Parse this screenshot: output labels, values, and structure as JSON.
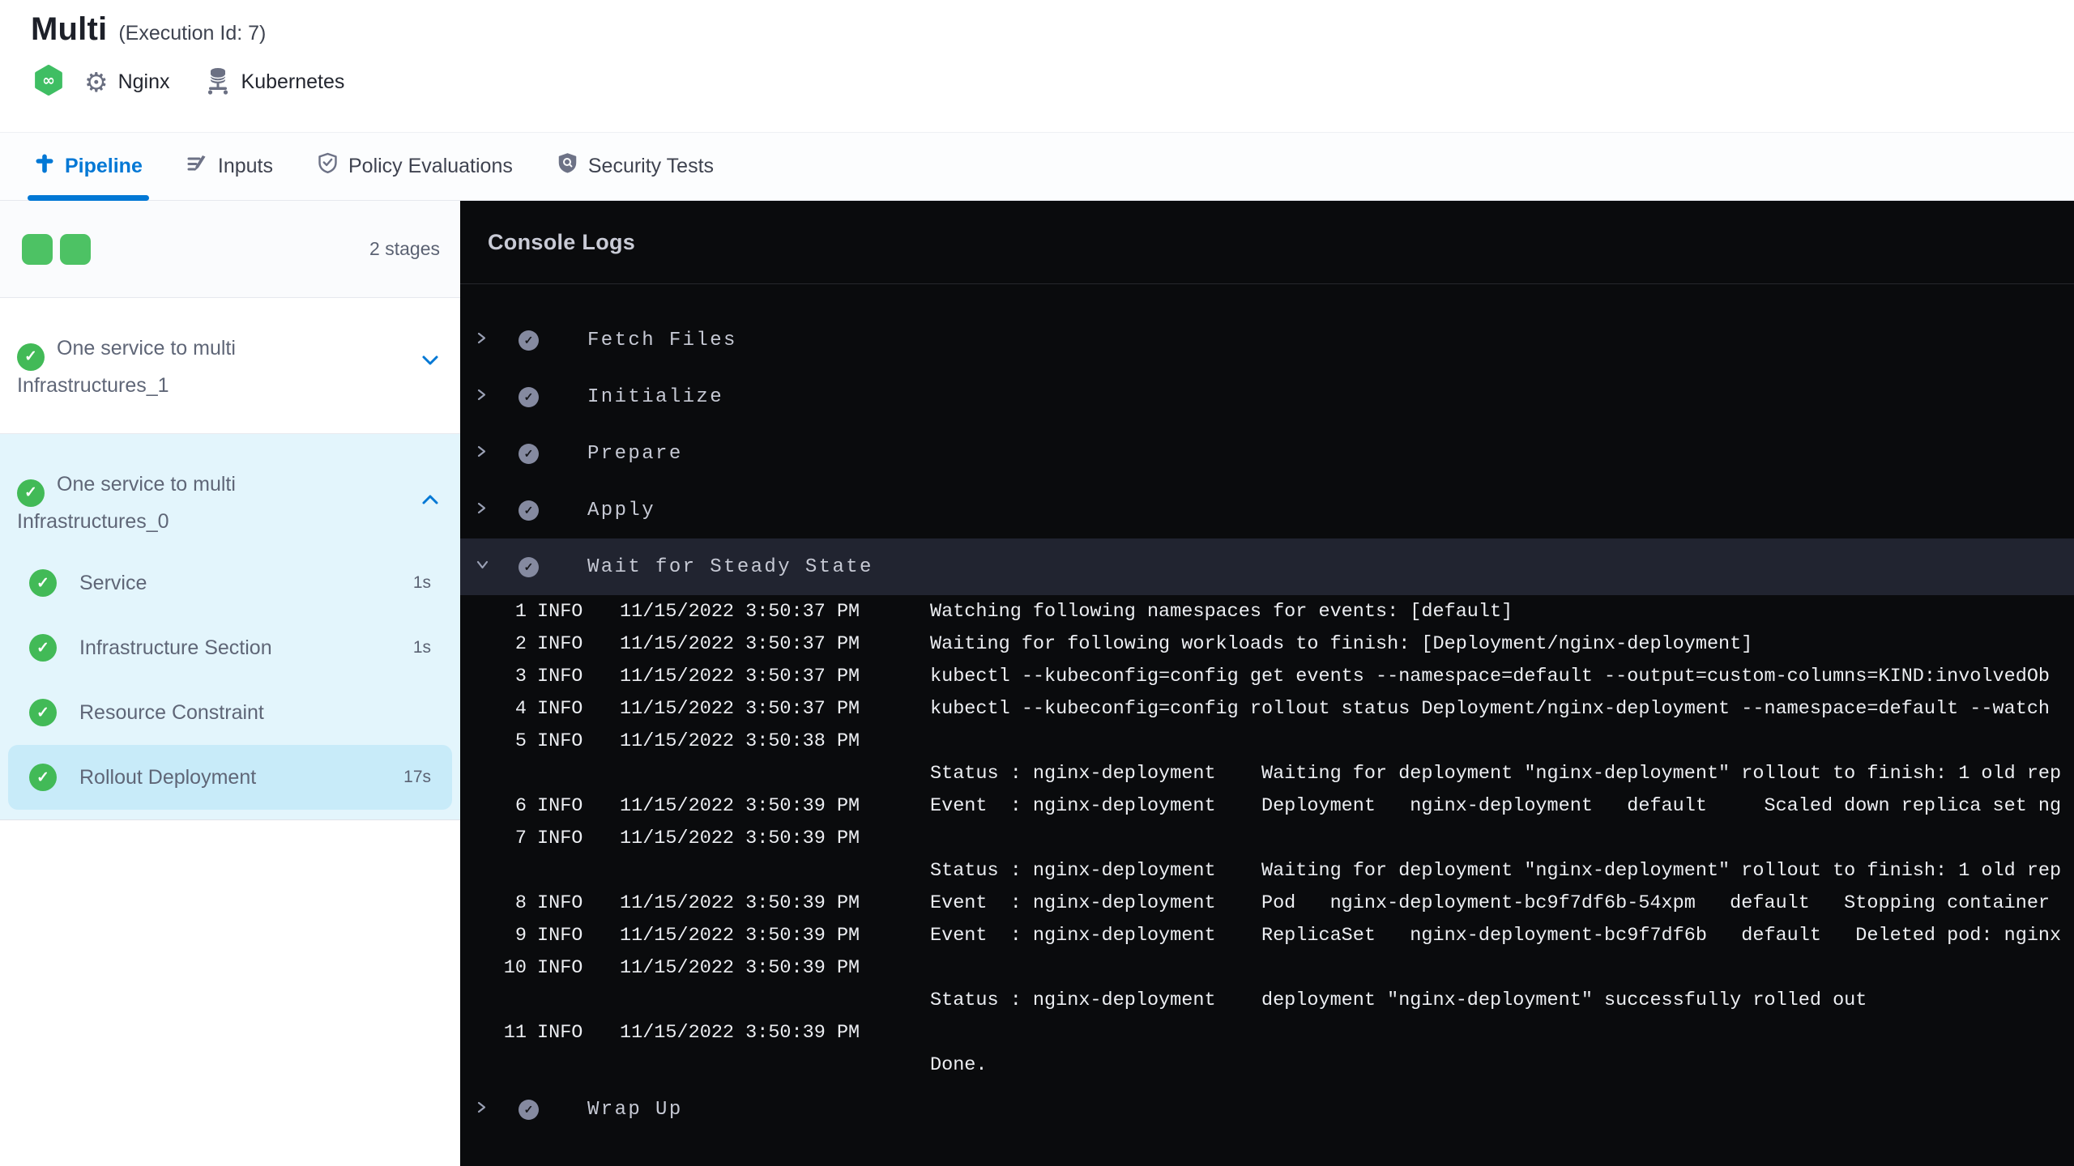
{
  "header": {
    "title": "Multi",
    "execution_id_label": "(Execution Id: 7)",
    "service_label": "Nginx",
    "infrastructure_label": "Kubernetes"
  },
  "tabs": [
    {
      "label": "Pipeline",
      "active": true
    },
    {
      "label": "Inputs",
      "active": false
    },
    {
      "label": "Policy Evaluations",
      "active": false
    },
    {
      "label": "Security Tests",
      "active": false
    }
  ],
  "sidebar": {
    "stage_count_label": "2 stages",
    "stages": [
      {
        "name": "One service to multi Infrastructures_1",
        "status": "success",
        "expanded": false
      },
      {
        "name": "One service to multi Infrastructures_0",
        "status": "success",
        "expanded": true,
        "steps": [
          {
            "label": "Service",
            "duration": "1s",
            "status": "success",
            "selected": false
          },
          {
            "label": "Infrastructure Section",
            "duration": "1s",
            "status": "success",
            "selected": false
          },
          {
            "label": "Resource Constraint",
            "duration": "",
            "status": "success",
            "selected": false
          },
          {
            "label": "Rollout Deployment",
            "duration": "17s",
            "status": "success",
            "selected": true
          }
        ]
      }
    ]
  },
  "console": {
    "title": "Console Logs",
    "steps": [
      {
        "label": "Fetch Files",
        "status": "success",
        "expanded": false
      },
      {
        "label": "Initialize",
        "status": "success",
        "expanded": false
      },
      {
        "label": "Prepare",
        "status": "success",
        "expanded": false
      },
      {
        "label": "Apply",
        "status": "success",
        "expanded": false
      },
      {
        "label": "Wait for Steady State",
        "status": "success",
        "expanded": true
      },
      {
        "label": "Wrap Up",
        "status": "success",
        "expanded": false
      }
    ],
    "log_lines": [
      {
        "num": "1",
        "level": "INFO",
        "time": "11/15/2022 3:50:37 PM",
        "msg": "Watching following namespaces for events: [default]"
      },
      {
        "num": "2",
        "level": "INFO",
        "time": "11/15/2022 3:50:37 PM",
        "msg": "Waiting for following workloads to finish: [Deployment/nginx-deployment]"
      },
      {
        "num": "3",
        "level": "INFO",
        "time": "11/15/2022 3:50:37 PM",
        "msg": "kubectl --kubeconfig=config get events --namespace=default --output=custom-columns=KIND:involvedOb"
      },
      {
        "num": "4",
        "level": "INFO",
        "time": "11/15/2022 3:50:37 PM",
        "msg": "kubectl --kubeconfig=config rollout status Deployment/nginx-deployment --namespace=default --watch"
      },
      {
        "num": "5",
        "level": "INFO",
        "time": "11/15/2022 3:50:38 PM",
        "msg": ""
      },
      {
        "num": "",
        "level": "",
        "time": "",
        "msg": "Status : nginx-deployment    Waiting for deployment \"nginx-deployment\" rollout to finish: 1 old rep"
      },
      {
        "num": "6",
        "level": "INFO",
        "time": "11/15/2022 3:50:39 PM",
        "msg": "Event  : nginx-deployment    Deployment   nginx-deployment   default     Scaled down replica set ng"
      },
      {
        "num": "7",
        "level": "INFO",
        "time": "11/15/2022 3:50:39 PM",
        "msg": ""
      },
      {
        "num": "",
        "level": "",
        "time": "",
        "msg": "Status : nginx-deployment    Waiting for deployment \"nginx-deployment\" rollout to finish: 1 old rep"
      },
      {
        "num": "8",
        "level": "INFO",
        "time": "11/15/2022 3:50:39 PM",
        "msg": "Event  : nginx-deployment    Pod   nginx-deployment-bc9f7df6b-54xpm   default   Stopping container"
      },
      {
        "num": "9",
        "level": "INFO",
        "time": "11/15/2022 3:50:39 PM",
        "msg": "Event  : nginx-deployment    ReplicaSet   nginx-deployment-bc9f7df6b   default   Deleted pod: nginx"
      },
      {
        "num": "10",
        "level": "INFO",
        "time": "11/15/2022 3:50:39 PM",
        "msg": ""
      },
      {
        "num": "",
        "level": "",
        "time": "",
        "msg": "Status : nginx-deployment    deployment \"nginx-deployment\" successfully rolled out"
      },
      {
        "num": "11",
        "level": "INFO",
        "time": "11/15/2022 3:50:39 PM",
        "msg": ""
      },
      {
        "num": "",
        "level": "",
        "time": "",
        "msg": "Done."
      }
    ]
  },
  "colors": {
    "accent_blue": "#0278d5",
    "success_green": "#42ba57",
    "stage_panel_blue": "#e3f5fc",
    "selected_step_blue": "#c8ebf9",
    "console_bg": "#0a0b0d",
    "console_highlight": "#212430"
  }
}
